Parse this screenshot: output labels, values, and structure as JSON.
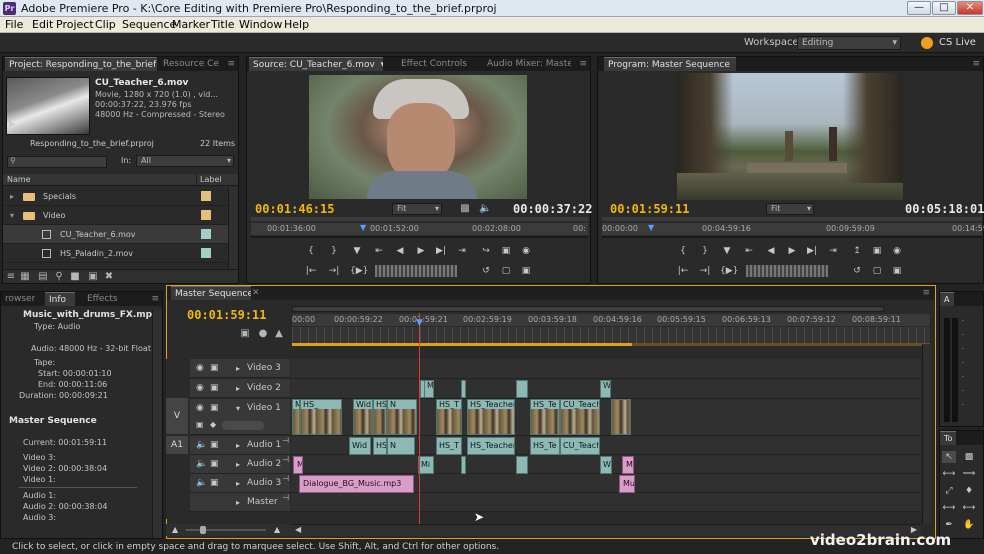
{
  "window": {
    "title": "Adobe Premiere Pro - K:\\Core Editing with Premiere Pro\\Responding_to_the_brief.prproj",
    "app_icon": "Pr",
    "controls": [
      "minimize-icon",
      "maximize-icon",
      "close-icon"
    ]
  },
  "menu": [
    "File",
    "Edit",
    "Project",
    "Clip",
    "Sequence",
    "Marker",
    "Title",
    "Window",
    "Help"
  ],
  "workspace": {
    "label": "Workspace:",
    "value": "Editing",
    "cslive": "CS Live"
  },
  "project_panel": {
    "tabs": [
      "Project: Responding_to_the_brief",
      "Resource Ce"
    ],
    "clip_name": "CU_Teacher_6.mov",
    "clip_type": "Movie, 1280 x 720 (1.0)  , vid...",
    "clip_duration": "00:00:37:22, 23.976 fps",
    "clip_audio": "48000 Hz - Compressed - Stereo",
    "project_file": "Responding_to_the_brief.prproj",
    "item_count": "22 Items",
    "search_placeholder": "",
    "in_label": "In:",
    "in_value": "All",
    "col_name": "Name",
    "col_label": "Label",
    "items": [
      {
        "name": "Specials",
        "kind": "folder",
        "label_color": "#e6c37a"
      },
      {
        "name": "Video",
        "kind": "folder",
        "label_color": "#e6c37a"
      },
      {
        "name": "CU_Teacher_6.mov",
        "kind": "clip",
        "label_color": "#a0d0c8"
      },
      {
        "name": "HS_Paladin_2.mov",
        "kind": "clip",
        "label_color": "#a0d0c8"
      }
    ]
  },
  "source_monitor": {
    "tabs": [
      "Source: CU_Teacher_6.mov",
      "Effect Controls",
      "Audio Mixer: Maste"
    ],
    "timecode_in": "00:01:46:15",
    "fit": "Fit",
    "duration": "00:00:37:22",
    "ruler": [
      "00:01:36:00",
      "00:01:52:00",
      "00:02:08:00",
      "00:"
    ]
  },
  "program_monitor": {
    "tabs": [
      "Program: Master Sequence"
    ],
    "timecode_in": "00:01:59:11",
    "fit": "Fit",
    "duration": "00:05:18:01",
    "ruler": [
      "00:00:00",
      "00:04:59:16",
      "00:09:59:09",
      "00:14:59:"
    ]
  },
  "info_panel": {
    "tabs": [
      "rowser",
      "Info",
      "Effects"
    ],
    "clip_name": "Music_with_drums_FX.mp3",
    "rows": [
      "Type:  Audio",
      "",
      "Audio:  48000 Hz - 32-bit Float -",
      "Tape:",
      "Start:  00:00:01:10",
      "End:  00:00:11:06",
      "Duration:  00:00:09:21"
    ],
    "seq_title": "Master Sequence",
    "seq_rows": [
      "Current:  00:01:59:11",
      "Video 3:",
      "Video 2:  00:00:38:04",
      "Video 1:",
      "Audio 1:",
      "Audio 2:  00:00:38:04",
      "Audio 3:"
    ]
  },
  "timeline": {
    "tab": "Master Sequence",
    "timecode": "00:01:59:11",
    "ruler": [
      "00:00",
      "00:00:59:22",
      "00:01:59:21",
      "00:02:59:19",
      "00:03:59:18",
      "00:04:59:16",
      "00:05:59:15",
      "00:06:59:13",
      "00:07:59:12",
      "00:08:59:11"
    ],
    "tracks": [
      {
        "name": "Video 3"
      },
      {
        "name": "Video 2"
      },
      {
        "name": "Video 1",
        "target": "V"
      },
      {
        "name": "Audio 1",
        "target": "A1"
      },
      {
        "name": "Audio 2"
      },
      {
        "name": "Audio 3"
      },
      {
        "name": "Master"
      }
    ],
    "clips": {
      "v2": [
        "Mi",
        "",
        "",
        "W"
      ],
      "v1": [
        "M",
        "HS_",
        "Wid",
        "HS",
        "N",
        "HS_T",
        "HS_Teacher",
        "HS_Te",
        "CU_Teach"
      ],
      "a1": [
        "Wid",
        "HS",
        "N",
        "HS_T",
        "HS_Teacher",
        "HS_Te",
        "CU_Teach"
      ],
      "a2": [
        "M",
        "Mi",
        "",
        "",
        "W",
        "M"
      ],
      "a3": [
        "Dialogue_BG_Music.mp3",
        "Mu"
      ]
    }
  },
  "tools_panel": {
    "tab": "To"
  },
  "status": "Click to select, or click in empty space and drag to marquee select. Use Shift, Alt, and Ctrl for other options.",
  "watermark": "video2brain.com"
}
